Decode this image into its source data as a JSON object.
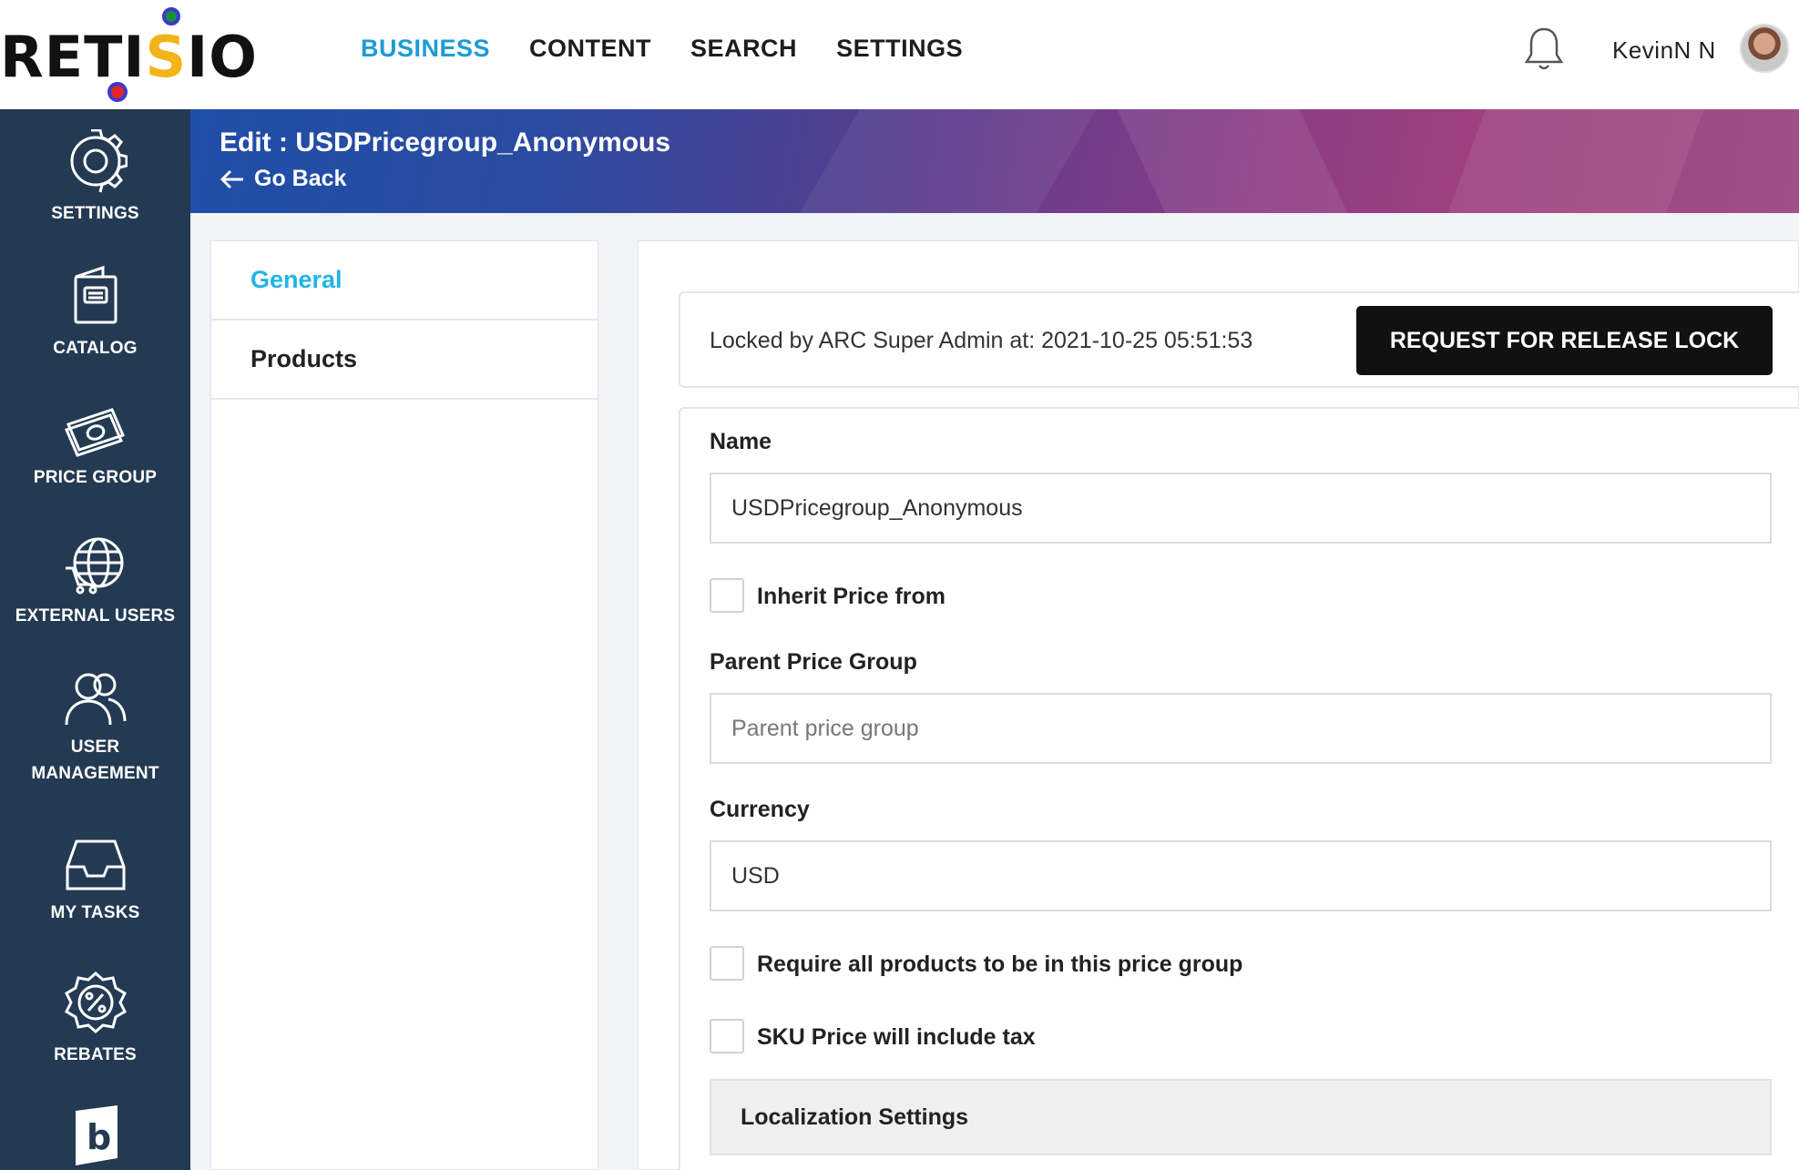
{
  "header": {
    "logo_text": "RETISIO",
    "nav": [
      {
        "label": "BUSINESS",
        "active": true
      },
      {
        "label": "CONTENT",
        "active": false
      },
      {
        "label": "SEARCH",
        "active": false
      },
      {
        "label": "SETTINGS",
        "active": false
      }
    ],
    "user_name": "KevinN N",
    "icons": {
      "notifications": "bell-icon",
      "avatar": "user-avatar"
    }
  },
  "sidebar": {
    "items": [
      {
        "label": "SETTINGS",
        "icon": "gear-icon"
      },
      {
        "label": "CATALOG",
        "icon": "catalog-icon"
      },
      {
        "label": "PRICE GROUP",
        "icon": "money-icon"
      },
      {
        "label": "EXTERNAL USERS",
        "icon": "globe-cart-icon"
      },
      {
        "label": "USER MANAGEMENT",
        "label_line1": "USER",
        "label_line2": "MANAGEMENT",
        "icon": "users-icon"
      },
      {
        "label": "MY TASKS",
        "icon": "inbox-icon"
      },
      {
        "label": "REBATES",
        "icon": "percent-badge-icon"
      },
      {
        "label": "",
        "icon": "b-logo-icon"
      }
    ]
  },
  "banner": {
    "title": "Edit : USDPricegroup_Anonymous",
    "go_back": "Go Back"
  },
  "subnav": {
    "items": [
      {
        "label": "General",
        "active": true
      },
      {
        "label": "Products",
        "active": false
      }
    ]
  },
  "lock": {
    "text": "Locked by ARC Super Admin at: 2021-10-25 05:51:53",
    "button": "REQUEST FOR RELEASE LOCK"
  },
  "form": {
    "name_label": "Name",
    "name_value": "USDPricegroup_Anonymous",
    "inherit_label": "Inherit Price from",
    "inherit_checked": false,
    "parent_label": "Parent Price Group",
    "parent_placeholder": "Parent price group",
    "currency_label": "Currency",
    "currency_value": "USD",
    "require_label": "Require all products to be in this price group",
    "require_checked": false,
    "sku_tax_label": "SKU Price will include tax",
    "sku_tax_checked": false,
    "localization_label": "Localization Settings"
  },
  "colors": {
    "sidebar_bg": "#243a53",
    "nav_active": "#1e9bd7",
    "subnav_active": "#22b3e6",
    "button_bg": "#111111"
  }
}
